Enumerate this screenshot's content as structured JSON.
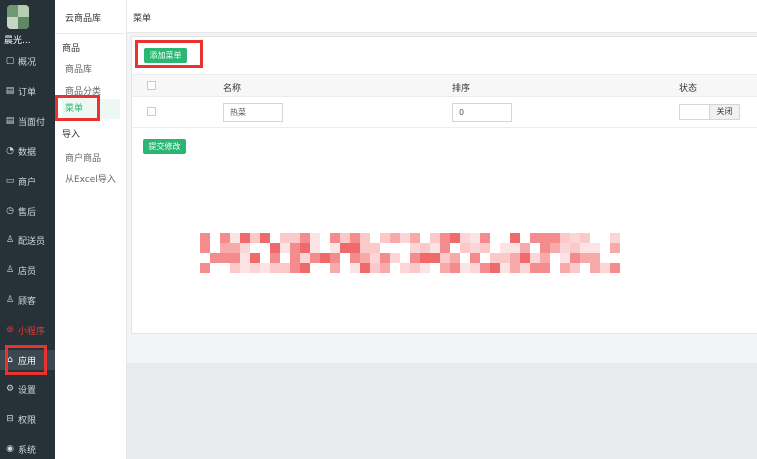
{
  "sidebar": {
    "brand": "晨光...",
    "items": [
      {
        "label": "概况",
        "icon": "▢"
      },
      {
        "label": "订单",
        "icon": "▤"
      },
      {
        "label": "当面付",
        "icon": "▤"
      },
      {
        "label": "数据",
        "icon": "◔"
      },
      {
        "label": "商户",
        "icon": "▭"
      },
      {
        "label": "售后",
        "icon": "◷"
      },
      {
        "label": "配送员",
        "icon": "♙"
      },
      {
        "label": "店员",
        "icon": "♙"
      },
      {
        "label": "顾客",
        "icon": "♙"
      },
      {
        "label": "小程序",
        "icon": "⊛"
      },
      {
        "label": "应用",
        "icon": "⌂"
      },
      {
        "label": "设置",
        "icon": "⚙"
      },
      {
        "label": "权限",
        "icon": "⊟"
      },
      {
        "label": "系统",
        "icon": "◉"
      }
    ]
  },
  "subnav": {
    "title": "云商品库",
    "group1": "商品",
    "items1": [
      "商品库",
      "商品分类",
      "菜单"
    ],
    "group2": "导入",
    "items2": [
      "商户商品",
      "从Excel导入"
    ]
  },
  "header": {
    "title": "菜单"
  },
  "toolbar": {
    "add_label": "添加菜单",
    "submit_label": "提交修改"
  },
  "table": {
    "columns": [
      "名称",
      "排序",
      "状态"
    ],
    "rows": [
      {
        "name": "热菜",
        "sort": "0",
        "status": "关闭"
      }
    ]
  },
  "colors": {
    "accent": "#2bb673",
    "sidebar": "#263238",
    "annotation": "#e8332e"
  }
}
